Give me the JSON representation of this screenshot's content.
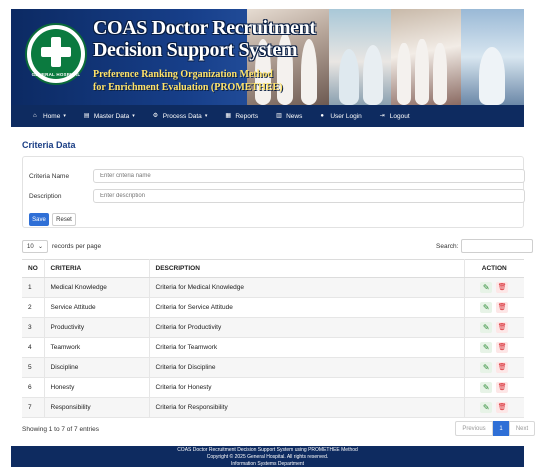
{
  "header": {
    "title_line1": "COAS Doctor Recruitment",
    "title_line2": "Decision Support System",
    "subtitle_line1": "Preference Ranking Organization Method",
    "subtitle_line2": "for Enrichment Evaluation (PROMETHEE)",
    "logo_text": "GENERAL HOSPITAL"
  },
  "nav": {
    "items": [
      {
        "label": "Home",
        "icon": "home-icon",
        "glyph": "⌂",
        "caret": "▾"
      },
      {
        "label": "Master Data",
        "icon": "database-icon",
        "glyph": "▤",
        "caret": "▾"
      },
      {
        "label": "Process Data",
        "icon": "gear-icon",
        "glyph": "⚙",
        "caret": "▾"
      },
      {
        "label": "Reports",
        "icon": "report-icon",
        "glyph": "▦",
        "caret": ""
      },
      {
        "label": "News",
        "icon": "news-icon",
        "glyph": "▥",
        "caret": ""
      },
      {
        "label": "User Login",
        "icon": "user-icon",
        "glyph": "●",
        "caret": ""
      },
      {
        "label": "Logout",
        "icon": "logout-icon",
        "glyph": "⇥",
        "caret": ""
      }
    ]
  },
  "page_title": "Criteria Data",
  "form": {
    "name_label": "Criteria Name",
    "name_placeholder": "Enter criteria name",
    "desc_label": "Description",
    "desc_placeholder": "Enter description",
    "save_label": "Save",
    "reset_label": "Reset"
  },
  "table_controls": {
    "page_size": "10",
    "records_label": "records per page",
    "search_label": "Search:"
  },
  "table": {
    "columns": [
      "NO",
      "CRITERIA",
      "DESCRIPTION",
      "ACTION"
    ],
    "rows": [
      {
        "no": "1",
        "criteria": "Medical Knowledge",
        "description": "Criteria for Medical Knowledge"
      },
      {
        "no": "2",
        "criteria": "Service Attitude",
        "description": "Criteria for Service Attitude"
      },
      {
        "no": "3",
        "criteria": "Productivity",
        "description": "Criteria for Productivity"
      },
      {
        "no": "4",
        "criteria": "Teamwork",
        "description": "Criteria for Teamwork"
      },
      {
        "no": "5",
        "criteria": "Discipline",
        "description": "Criteria for Discipline"
      },
      {
        "no": "6",
        "criteria": "Honesty",
        "description": "Criteria for Honesty"
      },
      {
        "no": "7",
        "criteria": "Responsibility",
        "description": "Criteria for Responsibility"
      }
    ]
  },
  "pagination": {
    "showing": "Showing 1 to 7 of 7 entries",
    "previous": "Previous",
    "current": "1",
    "next": "Next"
  },
  "footer": {
    "line1": "COAS Doctor Recruitment Decision Support System using PROMETHEE Method",
    "line2": "Copyright © 2025 General Hospital. All rights reserved.",
    "line3": "Information Systems Department"
  },
  "colors": {
    "nav_bg": "#0e2b60",
    "accent": "#2f6fd6",
    "title": "#1a3e85",
    "edit": "#2e8b37",
    "delete": "#d7262d"
  }
}
